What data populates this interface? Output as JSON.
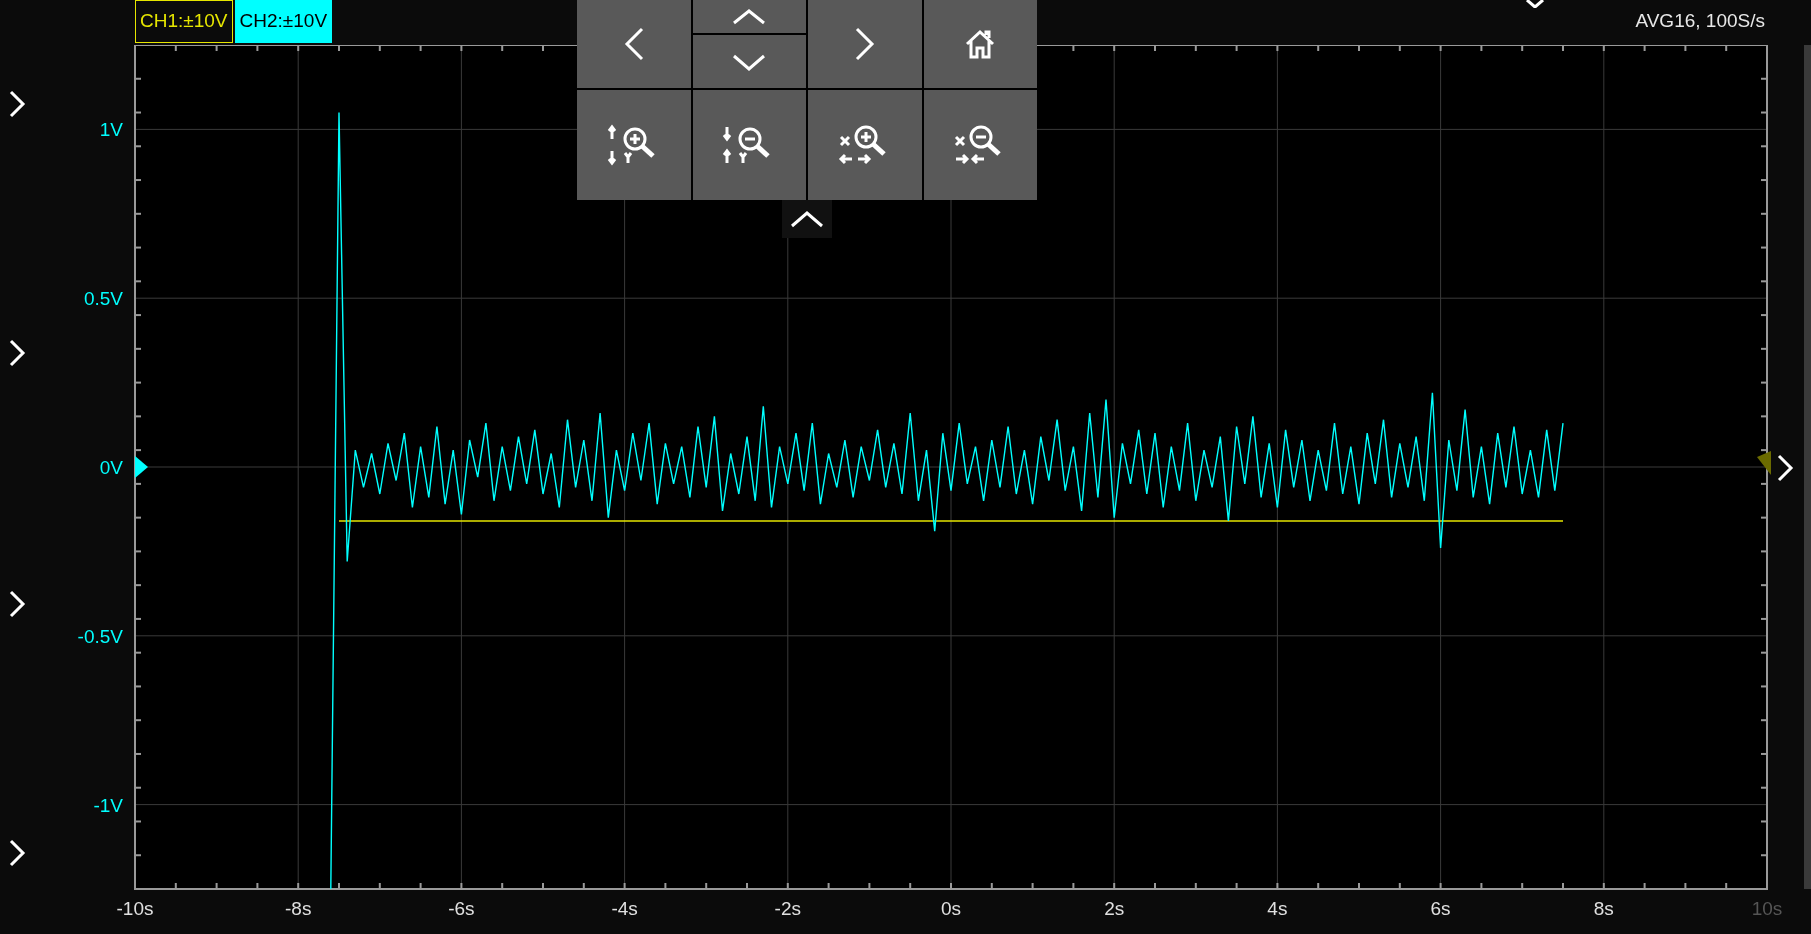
{
  "channels": [
    {
      "label": "CH1:±10V",
      "color": "#e6e600",
      "selected": false
    },
    {
      "label": "CH2:±10V",
      "color": "#00ffff",
      "selected": true
    }
  ],
  "status": "AVG16, 100S/s",
  "chart_data": {
    "type": "line",
    "grid": true,
    "xlim": [
      -10,
      10
    ],
    "ylim": [
      -1.25,
      1.25
    ],
    "x": [
      -7.6,
      -7.5,
      -7.4,
      -7.3,
      -7.2,
      -7.1,
      -7.0,
      -6.9,
      -6.8,
      -6.7,
      -6.6,
      -6.5,
      -6.4,
      -6.3,
      -6.2,
      -6.1,
      -6.0,
      -5.9,
      -5.8,
      -5.7,
      -5.6,
      -5.5,
      -5.4,
      -5.3,
      -5.2,
      -5.1,
      -5.0,
      -4.9,
      -4.8,
      -4.7,
      -4.6,
      -4.5,
      -4.4,
      -4.3,
      -4.2,
      -4.1,
      -4.0,
      -3.9,
      -3.8,
      -3.7,
      -3.6,
      -3.5,
      -3.4,
      -3.3,
      -3.2,
      -3.1,
      -3.0,
      -2.9,
      -2.8,
      -2.7,
      -2.6,
      -2.5,
      -2.4,
      -2.3,
      -2.2,
      -2.1,
      -2.0,
      -1.9,
      -1.8,
      -1.7,
      -1.6,
      -1.5,
      -1.4,
      -1.3,
      -1.2,
      -1.1,
      -1.0,
      -0.9,
      -0.8,
      -0.7,
      -0.6,
      -0.5,
      -0.4,
      -0.3,
      -0.2,
      -0.1,
      0.0,
      0.1,
      0.2,
      0.3,
      0.4,
      0.5,
      0.6,
      0.7,
      0.8,
      0.9,
      1.0,
      1.1,
      1.2,
      1.3,
      1.4,
      1.5,
      1.6,
      1.7,
      1.8,
      1.9,
      2.0,
      2.1,
      2.2,
      2.3,
      2.4,
      2.5,
      2.6,
      2.7,
      2.8,
      2.9,
      3.0,
      3.1,
      3.2,
      3.3,
      3.4,
      3.5,
      3.6,
      3.7,
      3.8,
      3.9,
      4.0,
      4.1,
      4.2,
      4.3,
      4.4,
      4.5,
      4.6,
      4.7,
      4.8,
      4.9,
      5.0,
      5.1,
      5.2,
      5.3,
      5.4,
      5.5,
      5.6,
      5.7,
      5.8,
      5.9,
      6.0,
      6.1,
      6.2,
      6.3,
      6.4,
      6.5,
      6.6,
      6.7,
      6.8,
      6.9,
      7.0,
      7.1,
      7.2,
      7.3,
      7.4,
      7.5
    ],
    "series": [
      {
        "color": "#e6e600",
        "values": [
          null,
          -0.16,
          -0.16,
          -0.16,
          -0.16,
          -0.16,
          -0.16,
          -0.16,
          -0.16,
          -0.16,
          -0.16,
          -0.16,
          -0.16,
          -0.16,
          -0.16,
          -0.16,
          -0.16,
          -0.16,
          -0.16,
          -0.16,
          -0.16,
          -0.16,
          -0.16,
          -0.16,
          -0.16,
          -0.16,
          -0.16,
          -0.16,
          -0.16,
          -0.16,
          -0.16,
          -0.16,
          -0.16,
          -0.16,
          -0.16,
          -0.16,
          -0.16,
          -0.16,
          -0.16,
          -0.16,
          -0.16,
          -0.16,
          -0.16,
          -0.16,
          -0.16,
          -0.16,
          -0.16,
          -0.16,
          -0.16,
          -0.16,
          -0.16,
          -0.16,
          -0.16,
          -0.16,
          -0.16,
          -0.16,
          -0.16,
          -0.16,
          -0.16,
          -0.16,
          -0.16,
          -0.16,
          -0.16,
          -0.16,
          -0.16,
          -0.16,
          -0.16,
          -0.16,
          -0.16,
          -0.16,
          -0.16,
          -0.16,
          -0.16,
          -0.16,
          -0.16,
          -0.16,
          -0.16,
          -0.16,
          -0.16,
          -0.16,
          -0.16,
          -0.16,
          -0.16,
          -0.16,
          -0.16,
          -0.16,
          -0.16,
          -0.16,
          -0.16,
          -0.16,
          -0.16,
          -0.16,
          -0.16,
          -0.16,
          -0.16,
          -0.16,
          -0.16,
          -0.16,
          -0.16,
          -0.16,
          -0.16,
          -0.16,
          -0.16,
          -0.16,
          -0.16,
          -0.16,
          -0.16,
          -0.16,
          -0.16,
          -0.16,
          -0.16,
          -0.16,
          -0.16,
          -0.16,
          -0.16,
          -0.16,
          -0.16,
          -0.16,
          -0.16,
          -0.16,
          -0.16,
          -0.16,
          -0.16,
          -0.16,
          -0.16,
          -0.16,
          -0.16,
          -0.16,
          -0.16,
          -0.16,
          -0.16,
          -0.16,
          -0.16,
          -0.16,
          -0.16,
          -0.16,
          -0.16,
          -0.16,
          -0.16,
          -0.16,
          -0.16,
          -0.16,
          -0.16,
          -0.16,
          -0.16,
          -0.16,
          -0.16,
          -0.16,
          -0.16,
          -0.16,
          -0.16,
          -0.16
        ]
      },
      {
        "color": "#00ffff",
        "values": [
          -1.25,
          1.05,
          -0.28,
          0.05,
          -0.06,
          0.04,
          -0.08,
          0.07,
          -0.04,
          0.1,
          -0.12,
          0.06,
          -0.09,
          0.12,
          -0.11,
          0.05,
          -0.14,
          0.08,
          -0.03,
          0.13,
          -0.1,
          0.06,
          -0.07,
          0.09,
          -0.05,
          0.11,
          -0.08,
          0.04,
          -0.12,
          0.14,
          -0.06,
          0.08,
          -0.1,
          0.16,
          -0.15,
          0.05,
          -0.07,
          0.1,
          -0.04,
          0.13,
          -0.11,
          0.07,
          -0.05,
          0.06,
          -0.09,
          0.12,
          -0.06,
          0.15,
          -0.13,
          0.04,
          -0.08,
          0.09,
          -0.1,
          0.18,
          -0.12,
          0.06,
          -0.05,
          0.1,
          -0.07,
          0.13,
          -0.11,
          0.04,
          -0.06,
          0.08,
          -0.09,
          0.06,
          -0.04,
          0.11,
          -0.06,
          0.07,
          -0.08,
          0.16,
          -0.1,
          0.05,
          -0.19,
          0.1,
          -0.07,
          0.13,
          -0.05,
          0.06,
          -0.1,
          0.08,
          -0.06,
          0.12,
          -0.08,
          0.05,
          -0.11,
          0.09,
          -0.04,
          0.14,
          -0.07,
          0.06,
          -0.13,
          0.16,
          -0.09,
          0.2,
          -0.15,
          0.07,
          -0.05,
          0.11,
          -0.08,
          0.1,
          -0.12,
          0.06,
          -0.07,
          0.13,
          -0.1,
          0.05,
          -0.06,
          0.09,
          -0.16,
          0.12,
          -0.05,
          0.15,
          -0.09,
          0.07,
          -0.12,
          0.11,
          -0.06,
          0.08,
          -0.1,
          0.05,
          -0.07,
          0.13,
          -0.08,
          0.06,
          -0.11,
          0.1,
          -0.05,
          0.14,
          -0.09,
          0.07,
          -0.06,
          0.09,
          -0.1,
          0.22,
          -0.24,
          0.08,
          -0.07,
          0.17,
          -0.09,
          0.06,
          -0.11,
          0.1,
          -0.06,
          0.12,
          -0.08,
          0.05,
          -0.09,
          0.11,
          -0.07,
          0.13
        ]
      }
    ],
    "xticks": [
      {
        "value": -10,
        "label": "-10s"
      },
      {
        "value": -8,
        "label": "-8s"
      },
      {
        "value": -6,
        "label": "-6s"
      },
      {
        "value": -4,
        "label": "-4s"
      },
      {
        "value": -2,
        "label": "-2s"
      },
      {
        "value": 0,
        "label": "0s"
      },
      {
        "value": 2,
        "label": "2s"
      },
      {
        "value": 4,
        "label": "4s"
      },
      {
        "value": 6,
        "label": "6s"
      },
      {
        "value": 8,
        "label": "8s"
      },
      {
        "value": 10,
        "label": "10s"
      }
    ],
    "yticks": [
      {
        "value": 1,
        "label": "1V"
      },
      {
        "value": 0.5,
        "label": "0.5V"
      },
      {
        "value": 0,
        "label": "0V"
      },
      {
        "value": -0.5,
        "label": "-0.5V"
      },
      {
        "value": -1,
        "label": "-1V"
      }
    ]
  }
}
